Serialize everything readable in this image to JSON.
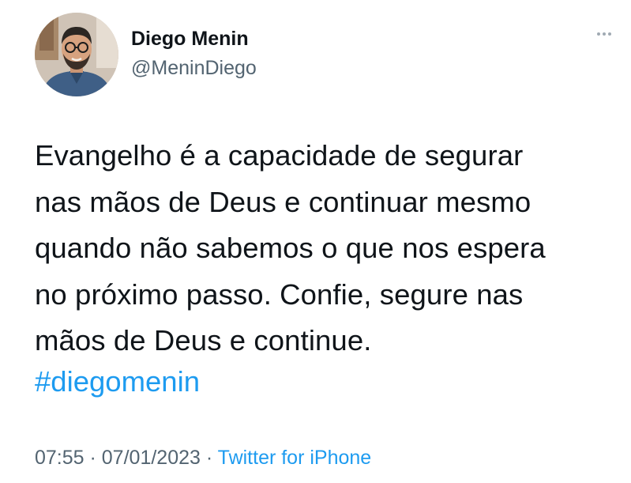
{
  "author": {
    "name": "Diego Menin",
    "handle": "@MeninDiego"
  },
  "more_icon": "more-horizontal-icon",
  "tweet": {
    "lines": [
      "Evangelho é a capacidade de segurar",
      "nas mãos de Deus e continuar mesmo",
      "quando não sabemos o que nos espera",
      "no próximo passo. Confie, segure nas",
      "mãos de Deus e continue."
    ],
    "hashtag": "#diegomenin"
  },
  "meta": {
    "time": "07:55",
    "separator1": " · ",
    "date": "07/01/2023",
    "separator2": " · ",
    "source": "Twitter for iPhone"
  },
  "colors": {
    "text": "#0f1419",
    "secondary": "#536471",
    "link": "#1d9bf0"
  }
}
